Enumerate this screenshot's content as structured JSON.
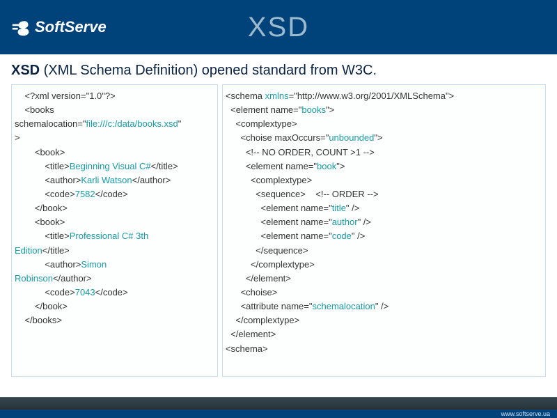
{
  "header": {
    "brand": "SoftServe",
    "title": "XSD"
  },
  "intro": {
    "bold": "XSD",
    "rest": " (XML Schema Definition) opened standard from W3C."
  },
  "xml_sample": {
    "xml_decl": "<?xml version=\"1.0\"?>",
    "books_open1": "<books",
    "schemalocation_label": "schemalocation=\"",
    "schemalocation_value": "file:///c:/data/books.xsd",
    "schemalocation_close": "\"",
    "gt": ">",
    "book_open": "<book>",
    "title_open": "<title>",
    "title1_value": "Beginning Visual C#",
    "title_close": "</title>",
    "author_open": "<author>",
    "author1_value": "Karli Watson",
    "author_close": "</author>",
    "code_open": "<code>",
    "code1_value": "7582",
    "code_close": "</code>",
    "book_close": "</book>",
    "title2_a": "Professional C# 3th",
    "title2_b": "Edition",
    "author2_a": "Simon",
    "author2_b": "Robinson",
    "code2_value": "7043",
    "books_close": "</books>"
  },
  "xsd_sample": {
    "schema_open_a": "<schema ",
    "xmlns_label": "xmlns",
    "schema_open_b": "=\"http://www.w3.org/2001/XMLSchema\">",
    "element_books_a": "<element name=\"",
    "books_val": "books",
    "dq_gt": "\">",
    "complextype_open": "<complextype>",
    "choise_open_a": "<choise maxOccurs=\"",
    "unbounded": "unbounded",
    "comment1": "<!-- NO ORDER, COUNT >1 -->",
    "element_book_a": "<element name=\"",
    "book_val": "book",
    "sequence_open": "<sequence>",
    "comment2": "    <!-- ORDER -->",
    "el_title_a": "<element name=\"",
    "title_val": "title",
    "selfclose": "\" />",
    "el_author_a": "<element name=\"",
    "author_val": "author",
    "el_code_a": "<element name=\"",
    "code_val": "code",
    "sequence_close": "</sequence>",
    "complextype_close": "</complextype>",
    "element_close": "</element>",
    "choise_close": "<choise>",
    "attr_open_a": "<attribute name=\"",
    "schemalocation_val": "schemalocation",
    "schema_close": "<schema>"
  },
  "footer": {
    "url": "www.softserve.ua"
  }
}
